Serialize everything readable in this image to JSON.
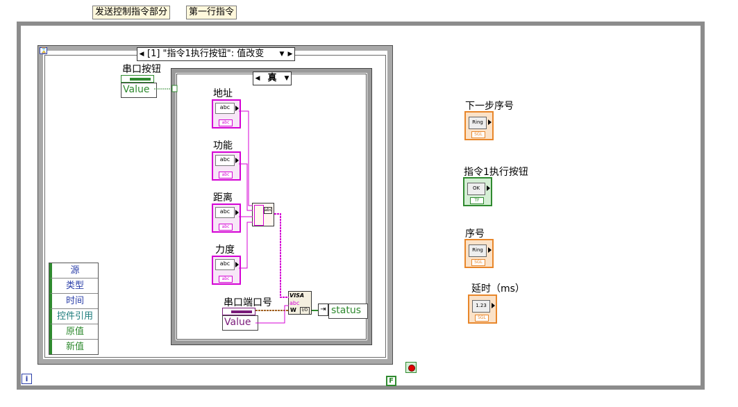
{
  "labels": {
    "send_section": "发送控制指令部分",
    "first_row": "第一行指令"
  },
  "event_structure": {
    "selector": "[1] \"指令1执行按钮\": 值改变",
    "serial_button_label": "串口按钮",
    "serial_button_value": "Value",
    "event_data_nodes": [
      "源",
      "类型",
      "时间",
      "控件引用",
      "原值",
      "新值"
    ],
    "case_structure": {
      "selector": "真",
      "string_constants": [
        {
          "label": "地址",
          "text": "abc"
        },
        {
          "label": "功能",
          "text": "abc"
        },
        {
          "label": "距离",
          "text": "abc"
        },
        {
          "label": "力度",
          "text": "abc"
        }
      ],
      "serial_port_label": "串口端口号",
      "serial_port_value": "Value",
      "status_label": "status",
      "visa_label": "VISA"
    }
  },
  "terminals": [
    {
      "label": "下一步序号",
      "type": "Ring",
      "foot": "SGL"
    },
    {
      "label": "指令1执行按钮",
      "type": "OK",
      "foot": "TF"
    },
    {
      "label": "序号",
      "type": "Ring",
      "foot": "SGL"
    },
    {
      "label": "延时（ms）",
      "type": "1.23",
      "foot": "SGL"
    }
  ],
  "loop": {
    "iteration_terminal": "i",
    "condition_terminal": "F"
  },
  "colors": {
    "string_wire": "#d400d4",
    "bool_wire": "#2f8a2f",
    "ring_wire": "#e8862a",
    "visa_wire": "#a06020"
  }
}
